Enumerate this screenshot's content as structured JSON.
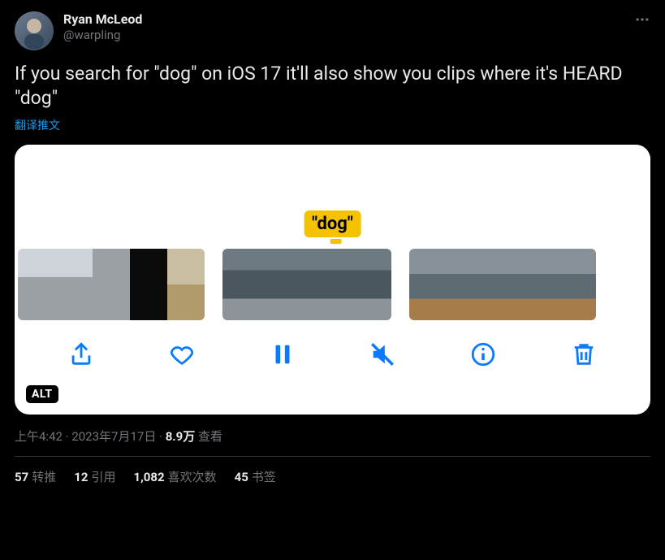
{
  "user": {
    "display_name": "Ryan McLeod",
    "handle": "@warpling"
  },
  "tweet": {
    "text": "If you search for \"dog\" on iOS 17 it'll also show you clips where it's HEARD \"dog\"",
    "translate": "翻译推文",
    "alt_badge": "ALT"
  },
  "media": {
    "search_label": "\"dog\""
  },
  "meta": {
    "time": "上午4:42",
    "date": "2023年7月17日",
    "views_count": "8.9万",
    "views_label": "查看",
    "separator": " · "
  },
  "stats": {
    "retweets": {
      "count": "57",
      "label": "转推"
    },
    "quotes": {
      "count": "12",
      "label": "引用"
    },
    "likes": {
      "count": "1,082",
      "label": "喜欢次数"
    },
    "bookmarks": {
      "count": "45",
      "label": "书签"
    }
  }
}
